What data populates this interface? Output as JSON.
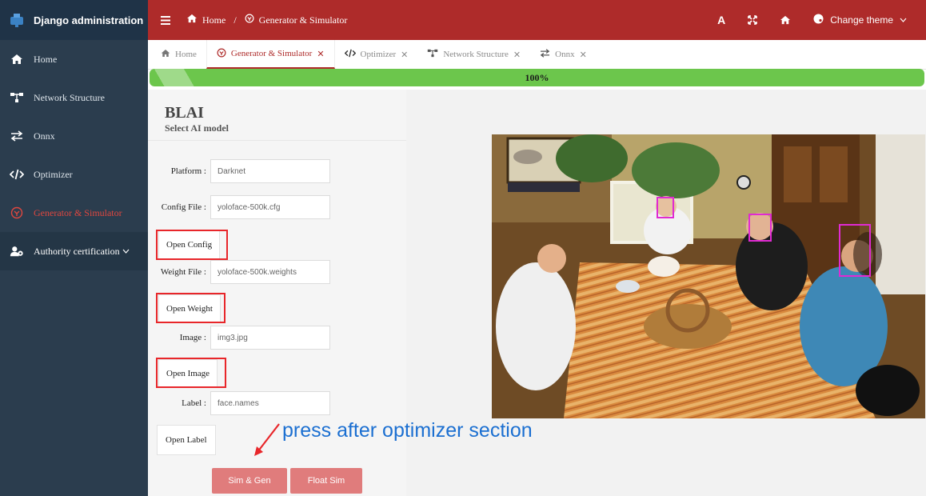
{
  "brand": {
    "title": "Django administration"
  },
  "sidebar": {
    "items": [
      {
        "label": "Home",
        "icon": "home-icon"
      },
      {
        "label": "Network Structure",
        "icon": "network-icon"
      },
      {
        "label": "Onnx",
        "icon": "exchange-icon"
      },
      {
        "label": "Optimizer",
        "icon": "code-icon"
      },
      {
        "label": "Generator & Simulator",
        "icon": "generator-icon",
        "active": true
      },
      {
        "label": "Authority certification",
        "icon": "users-icon"
      }
    ]
  },
  "topbar": {
    "breadcrumb": {
      "home": "Home",
      "separator": "/",
      "current": "Generator & Simulator"
    },
    "font_button": "A",
    "theme_label": "Change theme",
    "color": "#ae2b2a"
  },
  "tabs": [
    {
      "label": "Home",
      "closable": false
    },
    {
      "label": "Generator & Simulator",
      "closable": true,
      "active": true
    },
    {
      "label": "Optimizer",
      "closable": true
    },
    {
      "label": "Network Structure",
      "closable": true
    },
    {
      "label": "Onnx",
      "closable": true
    }
  ],
  "progress": {
    "percent_label": "100%",
    "value": 1.0,
    "color": "#6cc64c"
  },
  "panel": {
    "title": "BLAI",
    "subtitle": "Select AI model",
    "platform_label": "Platform :",
    "platform_value": "Darknet",
    "config_label": "Config File :",
    "config_value": "yoloface-500k.cfg",
    "open_config": "Open Config",
    "weight_label": "Weight File :",
    "weight_value": "yoloface-500k.weights",
    "open_weight": "Open Weight",
    "image_label": "Image :",
    "image_value": "img3.jpg",
    "open_image": "Open Image",
    "label_label": "Label :",
    "label_value": "face.names",
    "open_label": "Open Label",
    "sim_gen": "Sim & Gen",
    "float_sim": "Float Sim"
  },
  "annotation": {
    "text": "press after optimizer section",
    "color": "#1b6fd1"
  },
  "highlight_color": "#e8262a",
  "detection_color": "#e02ad2"
}
